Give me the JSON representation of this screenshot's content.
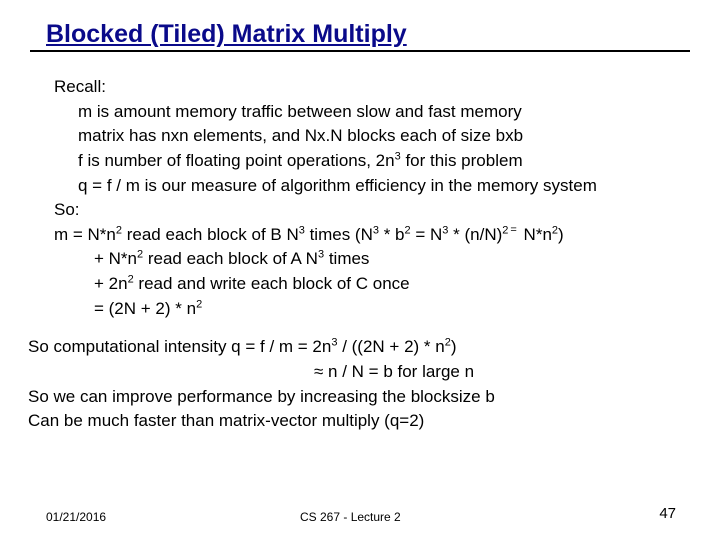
{
  "title": "Blocked (Tiled) Matrix Multiply",
  "body": {
    "l1": "Recall:",
    "l2": "m is amount memory traffic between slow and fast memory",
    "l3": "matrix has nxn elements, and Nx.N blocks each of size bxb",
    "l4_a": "f is number of floating point operations, 2n",
    "l4_b": " for this problem",
    "l5": "q = f / m is our measure of algorithm efficiency in the memory system",
    "l6": "So:",
    "l7_a": "m =  N*n",
    "l7_b": "    read each block of B  N",
    "l7_c": " times (N",
    "l7_d": " * b",
    "l7_e": " = N",
    "l7_f": " * (n/N)",
    "l7_g": " N*n",
    "l7_h": ")",
    "l8_a": "+ N*n",
    "l8_b": "   read each block of A  N",
    "l8_c": " times",
    "l9_a": "+ 2n",
    "l9_b": "       read and write each block of C once",
    "l10_a": "=  (2N + 2) * n"
  },
  "conc": {
    "c1_a": "So computational intensity q = f / m = 2n",
    "c1_b": " / ((2N + 2) * n",
    "c1_c": ")",
    "c2_a": "≈ n / N = b   for large n",
    "c3": "So we can improve performance by increasing the blocksize b",
    "c4": "Can be much faster than matrix-vector multiply (q=2)"
  },
  "footer": {
    "date": "01/21/2016",
    "mid": "CS 267 - Lecture 2",
    "num": "47"
  },
  "sup": {
    "two": "2",
    "three": "3",
    "eq": "="
  }
}
